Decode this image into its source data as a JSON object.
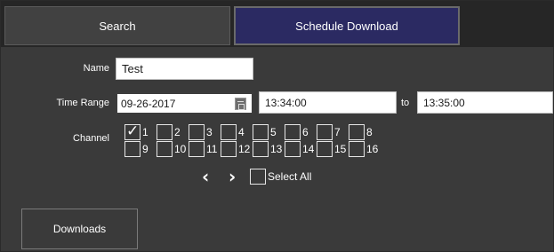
{
  "tabs": {
    "search_label": "Search",
    "schedule_label": "Schedule Download"
  },
  "form": {
    "name_label": "Name",
    "name_value": "Test",
    "time_range_label": "Time Range",
    "date_value": "09-26-2017",
    "start_time": "13:34:00",
    "to_label": "to",
    "end_time": "13:35:00",
    "channel_label": "Channel"
  },
  "channels": [
    {
      "number": "1",
      "checked": true
    },
    {
      "number": "2",
      "checked": false
    },
    {
      "number": "3",
      "checked": false
    },
    {
      "number": "4",
      "checked": false
    },
    {
      "number": "5",
      "checked": false
    },
    {
      "number": "6",
      "checked": false
    },
    {
      "number": "7",
      "checked": false
    },
    {
      "number": "8",
      "checked": false
    },
    {
      "number": "9",
      "checked": false
    },
    {
      "number": "10",
      "checked": false
    },
    {
      "number": "11",
      "checked": false
    },
    {
      "number": "12",
      "checked": false
    },
    {
      "number": "13",
      "checked": false
    },
    {
      "number": "14",
      "checked": false
    },
    {
      "number": "15",
      "checked": false
    },
    {
      "number": "16",
      "checked": false
    }
  ],
  "pager": {
    "prev_icon": "chevron-left-icon",
    "next_icon": "chevron-right-icon",
    "select_all_label": "Select All",
    "select_all_checked": false
  },
  "footer": {
    "downloads_label": "Downloads"
  },
  "colors": {
    "panel_bg": "#3a3a3a",
    "tabbar_bg": "#262626",
    "active_tab": "#2b2a62"
  }
}
